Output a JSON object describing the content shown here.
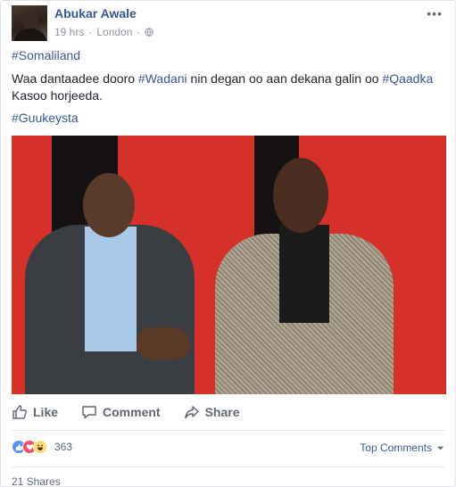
{
  "post": {
    "author": "Abukar Awale",
    "time": "19 hrs",
    "location": "London",
    "separator": "·",
    "more_label": "•••",
    "hashtag_somaliland": "#Somaliland",
    "body_part1": "Waa dantaadee dooro ",
    "hashtag_wadani": "#Wadani",
    "body_part2": " nin degan oo aan dekana galin oo ",
    "hashtag_qaadka": "#Qaadka",
    "body_part3": "Kasoo horjeeda.",
    "hashtag_guukeysta": "#Guukeysta",
    "photo_description_icon": "photo"
  },
  "actions": {
    "like_label": "Like",
    "comment_label": "Comment",
    "share_label": "Share"
  },
  "reactions": {
    "count": "363",
    "types": [
      "like-icon",
      "love-icon",
      "haha-icon"
    ]
  },
  "comments": {
    "sort_label": "Top Comments"
  },
  "shares": {
    "label": "21 Shares"
  },
  "colors": {
    "link": "#365899",
    "muted": "#90949c",
    "action": "#606770",
    "photo_background": "#d6302a"
  }
}
